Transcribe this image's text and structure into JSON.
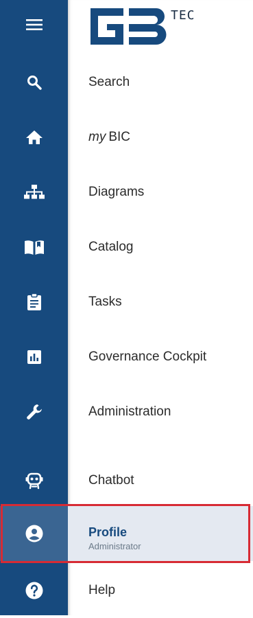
{
  "brand": {
    "logo_text": "TEC"
  },
  "menu": {
    "items": [
      {
        "id": "search",
        "label": "Search"
      },
      {
        "id": "mybic",
        "label_prefix": "my",
        "label": "BIC"
      },
      {
        "id": "diagrams",
        "label": "Diagrams"
      },
      {
        "id": "catalog",
        "label": "Catalog"
      },
      {
        "id": "tasks",
        "label": "Tasks"
      },
      {
        "id": "governance",
        "label": "Governance Cockpit"
      },
      {
        "id": "administration",
        "label": "Administration"
      },
      {
        "id": "chatbot",
        "label": "Chatbot"
      }
    ],
    "profile": {
      "label": "Profile",
      "role": "Administrator"
    },
    "help": {
      "label": "Help"
    }
  },
  "colors": {
    "rail": "#174a7e",
    "active_rail": "#3a6592",
    "active_panel": "#e4e9f1",
    "highlight_border": "#d72b34"
  }
}
